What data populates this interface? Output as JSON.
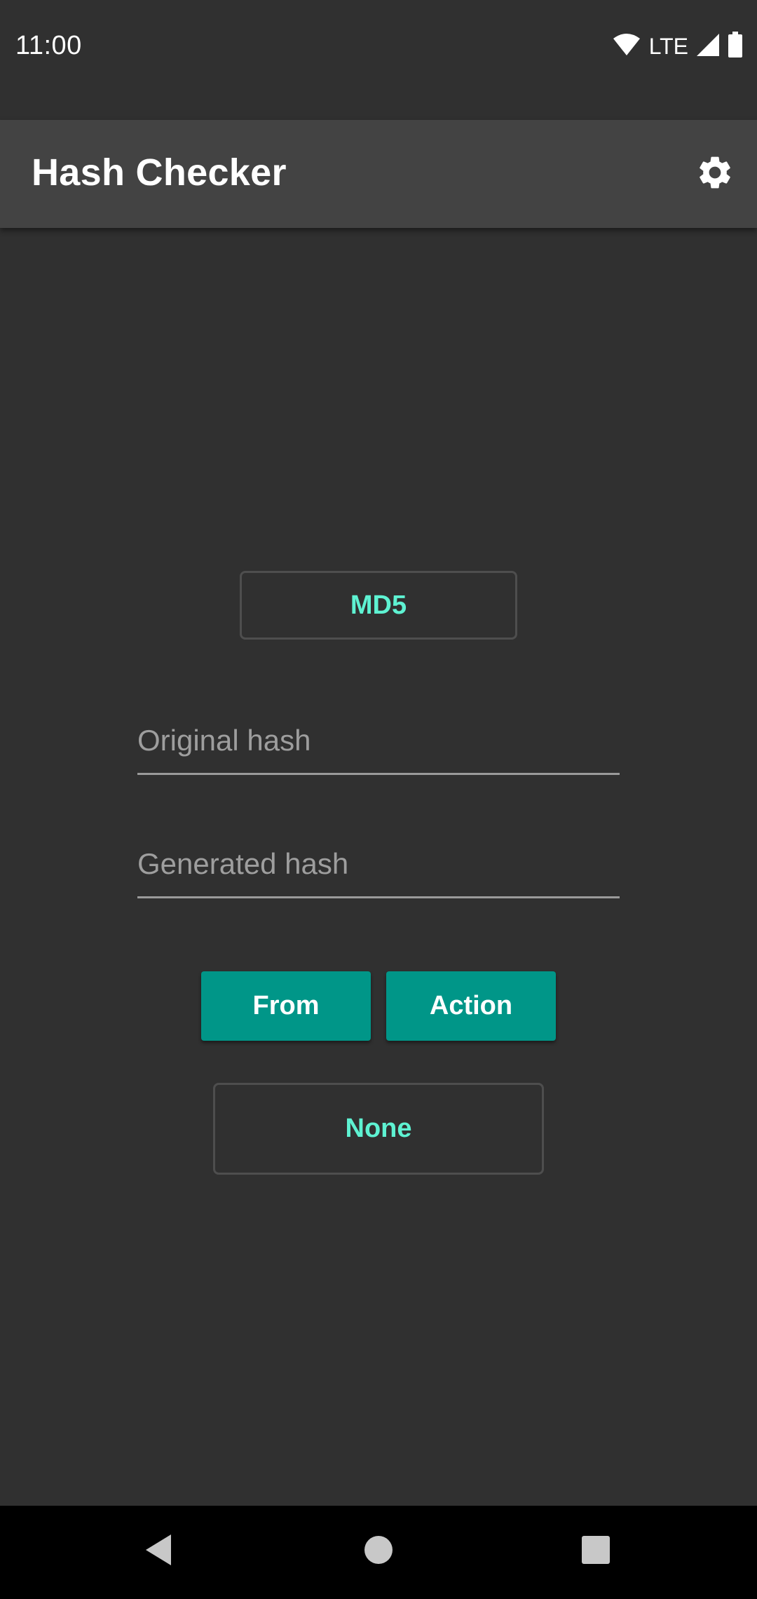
{
  "status_bar": {
    "time": "11:00",
    "network_label": "LTE",
    "icons": [
      "wifi-icon",
      "signal-icon",
      "battery-icon"
    ]
  },
  "app_bar": {
    "title": "Hash Checker",
    "settings_icon": "gear-icon"
  },
  "main": {
    "algorithm_button": "MD5",
    "original_hash": {
      "value": "",
      "placeholder": "Original hash"
    },
    "generated_hash": {
      "value": "",
      "placeholder": "Generated hash"
    },
    "from_button": "From",
    "action_button": "Action",
    "result_button": "None"
  },
  "nav_bar": {
    "icons": [
      "back-icon",
      "home-icon",
      "recents-icon"
    ]
  },
  "colors": {
    "background": "#303030",
    "app_bar": "#434343",
    "accent": "#5ef2d2",
    "primary_button": "#009688",
    "nav_bar": "#000000"
  }
}
